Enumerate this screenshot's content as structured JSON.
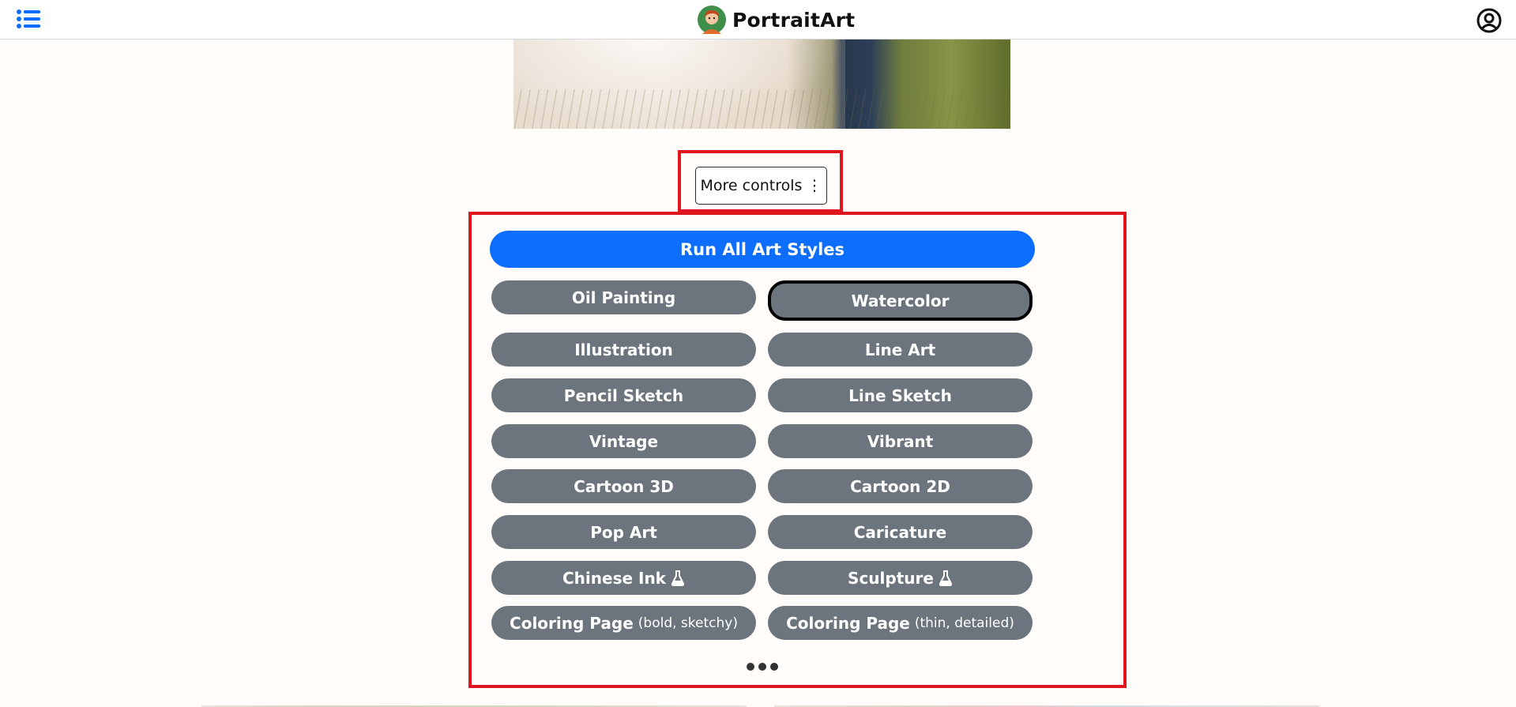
{
  "header": {
    "app_name": "PortraitArt",
    "menu_icon": "list-icon",
    "account_icon": "user-circle-icon",
    "logo": "portrait-avatar-logo"
  },
  "controls": {
    "more_controls_label": "More controls ⋮",
    "run_all_label": "Run All Art Styles",
    "styles": [
      {
        "label": "Oil Painting",
        "sub": "",
        "experimental": false
      },
      {
        "label": "Watercolor",
        "sub": "",
        "experimental": false,
        "selected": true
      },
      {
        "label": "Illustration",
        "sub": "",
        "experimental": false
      },
      {
        "label": "Line Art",
        "sub": "",
        "experimental": false
      },
      {
        "label": "Pencil Sketch",
        "sub": "",
        "experimental": false
      },
      {
        "label": "Line Sketch",
        "sub": "",
        "experimental": false
      },
      {
        "label": "Vintage",
        "sub": "",
        "experimental": false
      },
      {
        "label": "Vibrant",
        "sub": "",
        "experimental": false
      },
      {
        "label": "Cartoon 3D",
        "sub": "",
        "experimental": false
      },
      {
        "label": "Cartoon 2D",
        "sub": "",
        "experimental": false
      },
      {
        "label": "Pop Art",
        "sub": "",
        "experimental": false
      },
      {
        "label": "Caricature",
        "sub": "",
        "experimental": false
      },
      {
        "label": "Chinese Ink",
        "sub": "",
        "experimental": true
      },
      {
        "label": "Sculpture",
        "sub": "",
        "experimental": true
      },
      {
        "label": "Coloring Page",
        "sub": "(bold, sketchy)",
        "experimental": false
      },
      {
        "label": "Coloring Page",
        "sub": "(thin, detailed)",
        "experimental": false
      }
    ],
    "more_icon": "ellipsis-icon"
  },
  "colors": {
    "primary": "#0d6efd",
    "style_button": "#6c757d",
    "highlight": "#e0161e",
    "background": "#fffcfa"
  }
}
